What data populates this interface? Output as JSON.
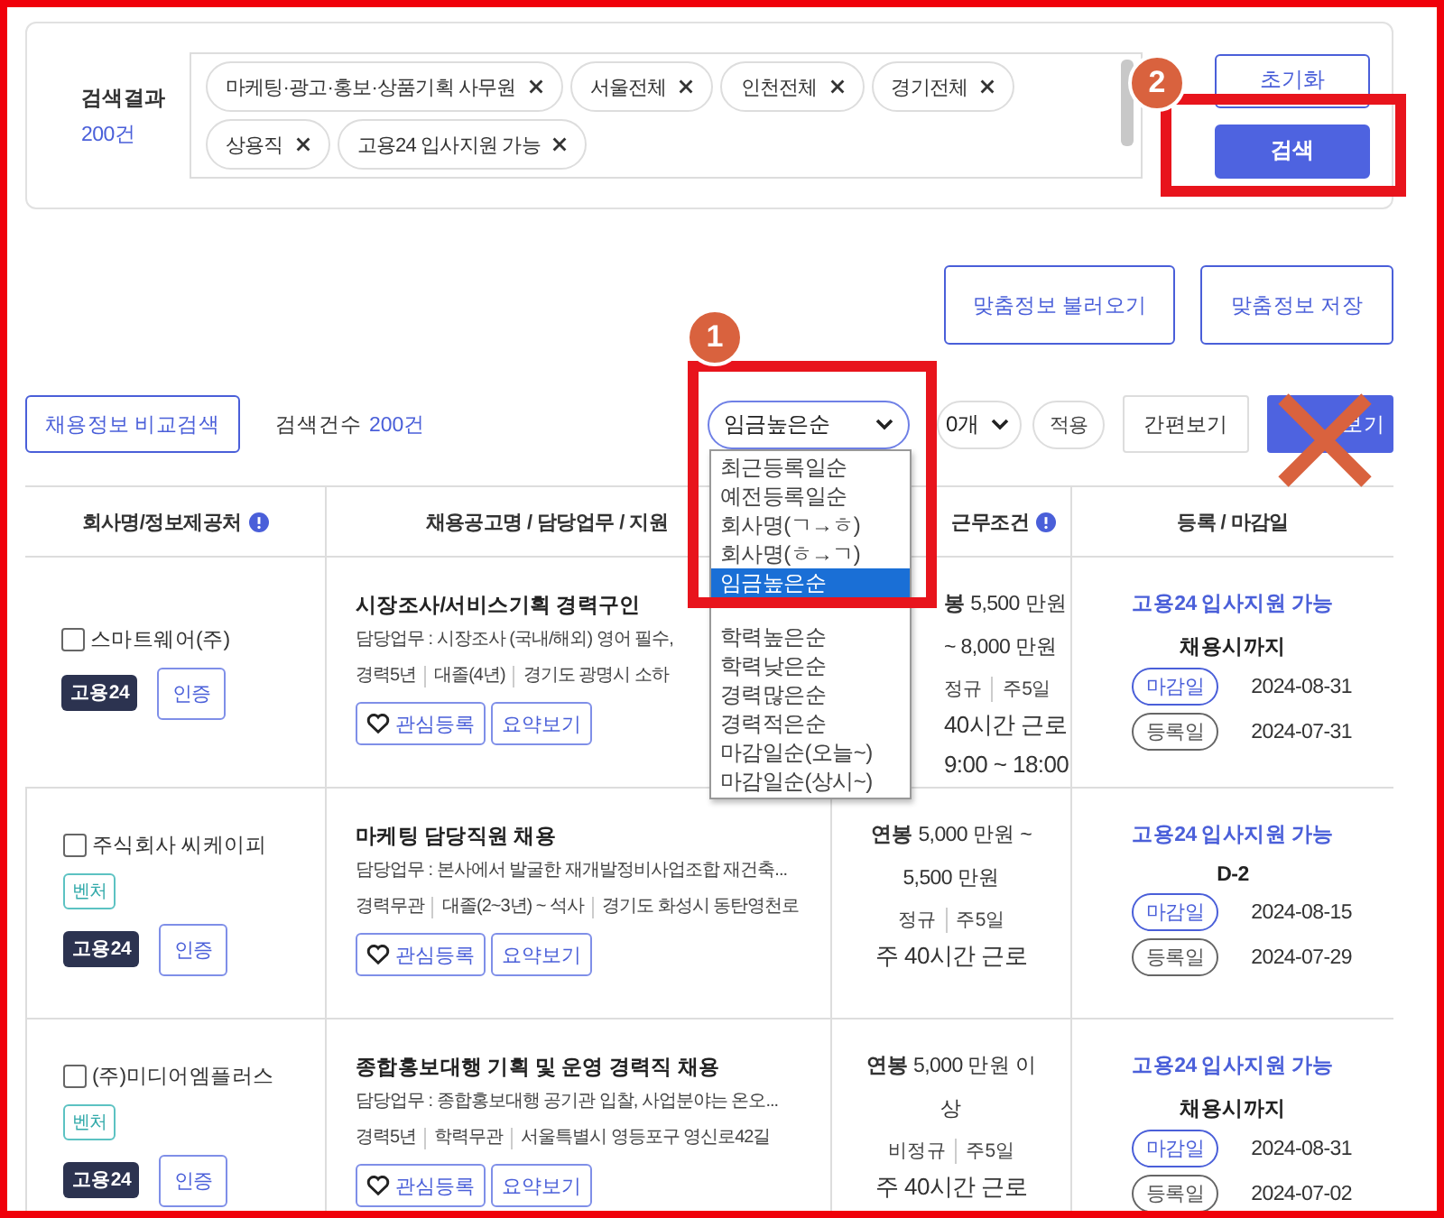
{
  "search_summary": {
    "label": "검색결과",
    "count": "200건"
  },
  "filter_tags": [
    {
      "label": "마케팅·광고·홍보·상품기획 사무원"
    },
    {
      "label": "서울전체"
    },
    {
      "label": "인천전체"
    },
    {
      "label": "경기전체"
    },
    {
      "label": "상용직"
    },
    {
      "label": "고용24 입사지원 가능"
    }
  ],
  "search_buttons": {
    "reset": "초기화",
    "search": "검색"
  },
  "custom_buttons": [
    "맞춤정보 불러오기",
    "맞춤정보 저장"
  ],
  "toolbar": {
    "compare": "채용정보 비교검색",
    "count_label": "검색건수",
    "count": "200건",
    "sort": "임금높은순",
    "page_size": "0개",
    "apply": "적용",
    "simple_view": "간편보기",
    "detail_view": "보기"
  },
  "sort_menu": [
    {
      "label": "최근등록일순",
      "selected": false
    },
    {
      "label": "예전등록일순",
      "selected": false
    },
    {
      "label": "회사명(ㄱ→ㅎ)",
      "selected": false
    },
    {
      "label": "회사명(ㅎ→ㄱ)",
      "selected": false
    },
    {
      "label": "임금높은순",
      "selected": true
    },
    {
      "label": "학력높은순",
      "selected": false
    },
    {
      "label": "학력낮은순",
      "selected": false
    },
    {
      "label": "경력많은순",
      "selected": false
    },
    {
      "label": "경력적은순",
      "selected": false
    },
    {
      "label": "마감일순(오늘~)",
      "selected": false
    },
    {
      "label": "마감일순(상시~)",
      "selected": false
    }
  ],
  "table": {
    "columns": [
      {
        "label": "회사명/정보제공처",
        "info": true
      },
      {
        "label": "채용공고명 / 담당업무 / 지원",
        "info": false
      },
      {
        "label": "근무조건",
        "info": true
      },
      {
        "label": "등록 / 마감일",
        "info": false
      }
    ],
    "rows": [
      {
        "company": "스마트웨어(주)",
        "checked": false,
        "tags": [],
        "source": "고용24",
        "cert": "인증",
        "title": "시장조사/서비스기획 경력구인",
        "duty": "담당업무 : 시장조사 (국내/해외) 영어 필수,",
        "meta": [
          "경력5년",
          "대졸(4년)",
          "경기도 광명시 소하"
        ],
        "actions": [
          "관심등록",
          "요약보기"
        ],
        "salary": "**봉** 5,500 만원 ~ 8,000 만원",
        "terms": [
          "정규",
          "주5일"
        ],
        "hours": "40시간 근로",
        "time": "9:00 ~ 18:00",
        "status": "고용24 입사지원 가능",
        "deadline": "채용시까지",
        "dates": [
          {
            "label": "마감일",
            "date": "2024-08-31",
            "kind": "deadline"
          },
          {
            "label": "등록일",
            "date": "2024-07-31",
            "kind": "registered"
          }
        ]
      },
      {
        "company": "주식회사 씨케이피",
        "checked": false,
        "tags": [
          "벤처"
        ],
        "source": "고용24",
        "cert": "인증",
        "title": "마케팅 담당직원 채용",
        "duty": "담당업무 : 본사에서 발굴한 재개발정비사업조합 재건축...",
        "meta": [
          "경력무관",
          "대졸(2~3년) ~ 석사",
          "경기도 화성시 동탄영천로"
        ],
        "actions": [
          "관심등록",
          "요약보기"
        ],
        "salary": "**연봉** 5,000 만원 ~ 5,500 만원",
        "terms": [
          "정규",
          "주5일"
        ],
        "hours": "주 40시간 근로",
        "status": "고용24 입사지원 가능",
        "deadline": "D-2",
        "dates": [
          {
            "label": "마감일",
            "date": "2024-08-15",
            "kind": "deadline"
          },
          {
            "label": "등록일",
            "date": "2024-07-29",
            "kind": "registered"
          }
        ]
      },
      {
        "company": "(주)미디어엠플러스",
        "checked": false,
        "tags": [
          "벤처"
        ],
        "source": "고용24",
        "cert": "인증",
        "title": "종합홍보대행 기획 및 운영 경력직 채용",
        "duty": "담당업무 : 종합홍보대행 공기관 입찰, 사업분야는 온오...",
        "meta": [
          "경력5년",
          "학력무관",
          "서울특별시 영등포구 영신로42길"
        ],
        "actions": [
          "관심등록",
          "요약보기"
        ],
        "salary": "**연봉** 5,000 만원 이상",
        "terms": [
          "비정규",
          "주5일"
        ],
        "hours": "주 40시간 근로",
        "status": "고용24 입사지원 가능",
        "deadline": "채용시까지",
        "dates": [
          {
            "label": "마감일",
            "date": "2024-08-31",
            "kind": "deadline"
          },
          {
            "label": "등록일",
            "date": "2024-07-02",
            "kind": "registered"
          }
        ]
      }
    ]
  },
  "annotations": {
    "sort_badge": "1",
    "search_badge": "2",
    "cross_mark": true
  }
}
